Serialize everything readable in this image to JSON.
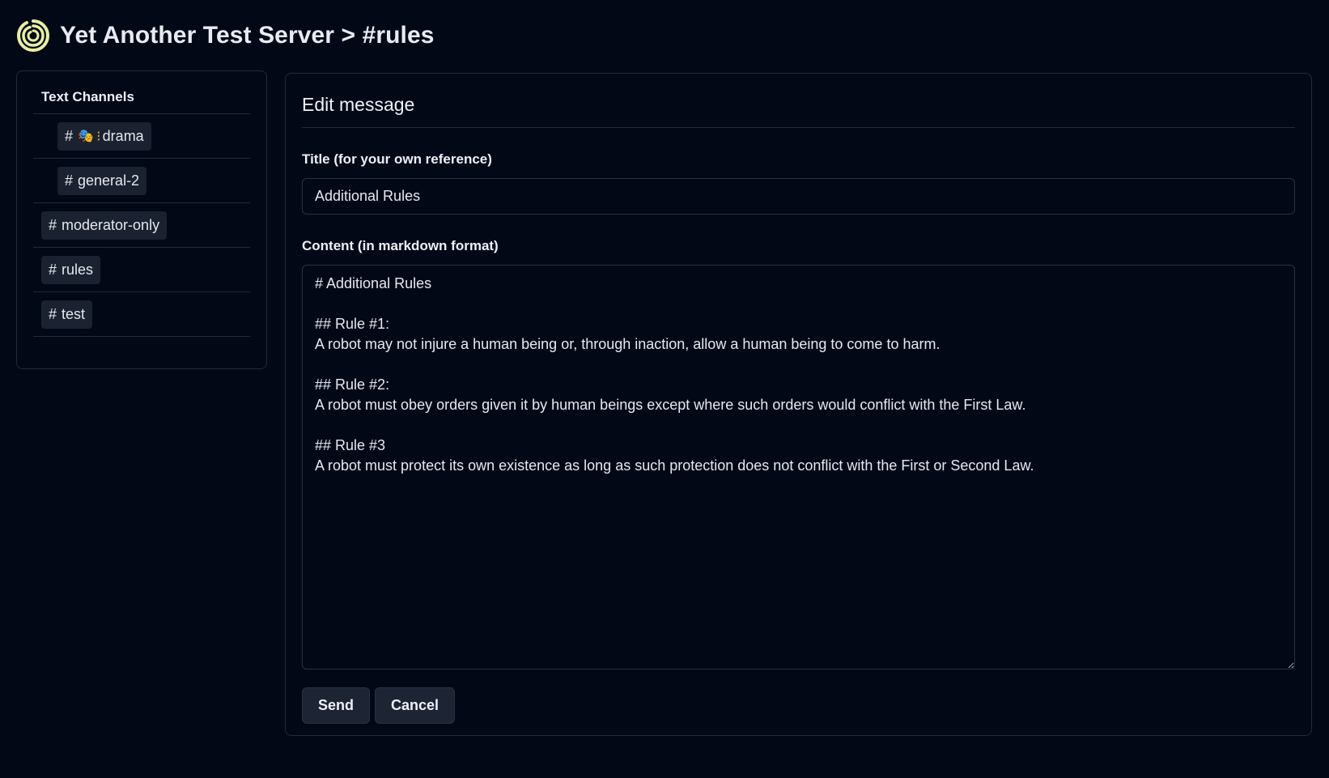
{
  "header": {
    "logo_icon": "spiral-logo-icon",
    "title": "Yet Another Test Server > #rules"
  },
  "sidebar": {
    "heading": "Text Channels",
    "channels": [
      {
        "prefix": "#",
        "emoji": "🎭",
        "separator": "⁝",
        "name": "drama",
        "nested": true
      },
      {
        "prefix": "#",
        "name": "general-2",
        "nested": true
      },
      {
        "prefix": "#",
        "name": "moderator-only",
        "nested": false
      },
      {
        "prefix": "#",
        "name": "rules",
        "nested": false
      },
      {
        "prefix": "#",
        "name": "test",
        "nested": false
      }
    ]
  },
  "editor": {
    "title": "Edit message",
    "title_label": "Title (for your own reference)",
    "title_value": "Additional Rules",
    "content_label": "Content (in markdown format)",
    "content_value": "# Additional Rules\n\n## Rule #1:\nA robot may not injure a human being or, through inaction, allow a human being to come to harm.\n\n## Rule #2:\nA robot must obey orders given it by human beings except where such orders would conflict with the First Law.\n\n## Rule #3\nA robot must protect its own existence as long as such protection does not conflict with the First or Second Law.",
    "send_label": "Send",
    "cancel_label": "Cancel"
  },
  "colors": {
    "background": "#030817",
    "border": "#232a38",
    "pill": "#1a2130",
    "logo": "#e8f0a0"
  }
}
